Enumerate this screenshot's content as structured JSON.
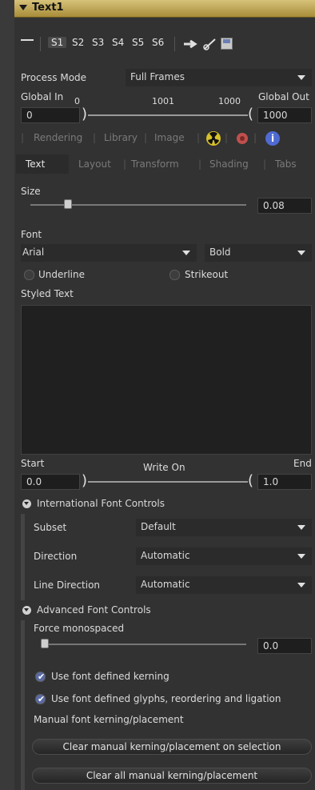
{
  "header": {
    "title": "Text1"
  },
  "toolbar": {
    "slots": [
      "S1",
      "S2",
      "S3",
      "S4",
      "S5",
      "S6"
    ]
  },
  "process_mode": {
    "label": "Process Mode",
    "value": "Full Frames"
  },
  "global_range": {
    "in_label": "Global In",
    "out_label": "Global Out",
    "in_value": "0",
    "out_value": "1000",
    "tick_start": "0",
    "tick_mid": "1001",
    "tick_end": "1000"
  },
  "tabs_row1": [
    "Rendering",
    "Library",
    "Image"
  ],
  "tabs_row2": [
    "Text",
    "Layout",
    "Transform",
    "Shading",
    "Tabs"
  ],
  "size": {
    "label": "Size",
    "value": "0.08"
  },
  "font": {
    "label": "Font",
    "family": "Arial",
    "style": "Bold"
  },
  "checkboxes": {
    "underline": "Underline",
    "strikeout": "Strikeout"
  },
  "styled_text": {
    "label": "Styled Text"
  },
  "write_on": {
    "start_label": "Start",
    "center_label": "Write On",
    "end_label": "End",
    "start_value": "0.0",
    "end_value": "1.0"
  },
  "international": {
    "title": "International Font Controls",
    "subset_label": "Subset",
    "subset_value": "Default",
    "direction_label": "Direction",
    "direction_value": "Automatic",
    "line_direction_label": "Line Direction",
    "line_direction_value": "Automatic"
  },
  "advanced": {
    "title": "Advanced Font Controls",
    "mono_label": "Force monospaced",
    "mono_value": "0.0",
    "kerning_label": "Use font defined kerning",
    "glyphs_label": "Use font defined glyphs, reordering and ligation",
    "manual_label": "Manual font kerning/placement",
    "clear_selection_button": "Clear manual kerning/placement on selection",
    "clear_all_button": "Clear all manual kerning/placement"
  },
  "colors": {
    "header": "#c9b25c",
    "checkbox_on": "#596aa4",
    "info": "#4f6bd1",
    "gear": "#c0504d",
    "radiation": "#d7c12a"
  }
}
